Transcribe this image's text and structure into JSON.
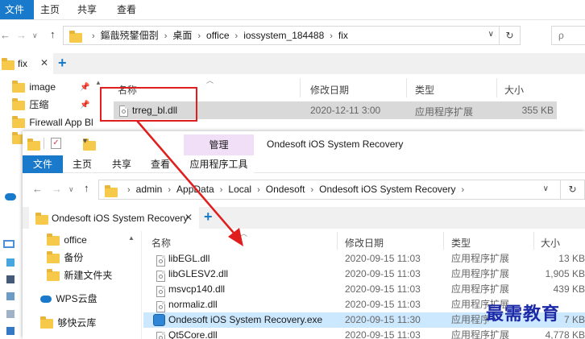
{
  "back_window": {
    "ribbon_tabs": [
      "文件",
      "主页",
      "共享",
      "查看"
    ],
    "address": {
      "crumbs": [
        "鏂戠殑鐢佃剳",
        "桌面",
        "office",
        "iossystem_184488",
        "fix"
      ]
    },
    "search_placeholder": "ρ",
    "tab": {
      "label": "fix"
    },
    "sidebar": [
      "image",
      "压缩",
      "Firewall App Bl"
    ],
    "columns": [
      "名称",
      "修改日期",
      "类型",
      "大小"
    ],
    "file": {
      "name": "trreg_bl.dll",
      "date": "2020-12-11 3:00",
      "type": "应用程序扩展",
      "size": "355 KB"
    }
  },
  "front_window": {
    "context_group": "管理",
    "context_tab": "应用程序工具",
    "title": "Ondesoft iOS System Recovery",
    "ribbon_tabs": [
      "文件",
      "主页",
      "共享",
      "查看"
    ],
    "address": {
      "crumbs": [
        "admin",
        "AppData",
        "Local",
        "Ondesoft",
        "Ondesoft iOS System Recovery"
      ]
    },
    "tab": {
      "label": "Ondesoft iOS System Recovery"
    },
    "sidebar": [
      "office",
      "备份",
      "新建文件夹",
      "WPS云盘",
      "够快云库"
    ],
    "columns": [
      "名称",
      "修改日期",
      "类型",
      "大小"
    ],
    "files": [
      {
        "name": "libEGL.dll",
        "date": "2020-09-15 11:03",
        "type": "应用程序扩展",
        "size": "13 KB"
      },
      {
        "name": "libGLESV2.dll",
        "date": "2020-09-15 11:03",
        "type": "应用程序扩展",
        "size": "1,905 KB"
      },
      {
        "name": "msvcp140.dll",
        "date": "2020-09-15 11:03",
        "type": "应用程序扩展",
        "size": "439 KB"
      },
      {
        "name": "normaliz.dll",
        "date": "2020-09-15 11:03",
        "type": "应用程序扩展",
        "size": ""
      },
      {
        "name": "Ondesoft iOS System Recovery.exe",
        "date": "2020-09-15 11:30",
        "type": "应用程序",
        "size": "7 KB"
      },
      {
        "name": "Qt5Core.dll",
        "date": "2020-09-15 11:03",
        "type": "应用程序扩展",
        "size": "4,778 KB"
      }
    ]
  },
  "watermark": "最需教育",
  "colors": {
    "accent": "#1979ca",
    "selected_row": "#cce8ff",
    "highlight_box": "#e01e1e",
    "context_group": "#f0dff7"
  }
}
